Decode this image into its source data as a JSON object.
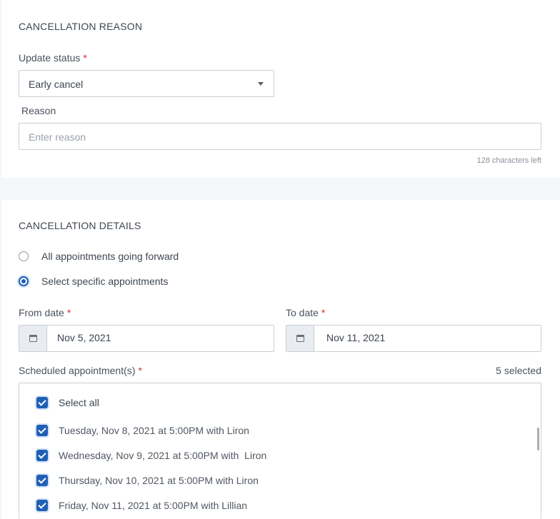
{
  "reason_section": {
    "title": "CANCELLATION REASON",
    "status_label": "Update status",
    "required_mark": "*",
    "status_value": "Early cancel",
    "reason_label": "Reason",
    "reason_placeholder": "Enter reason",
    "chars_left": "128 characters left"
  },
  "details_section": {
    "title": "CANCELLATION DETAILS",
    "options": [
      {
        "label": "All appointments going forward",
        "selected": false
      },
      {
        "label": "Select specific appointments",
        "selected": true
      }
    ],
    "from_label": "From date",
    "from_value": "Nov 5, 2021",
    "to_label": "To date",
    "to_value": "Nov 11, 2021",
    "required_mark": "*",
    "appointments_label": "Scheduled appointment(s)",
    "selected_count": "5 selected",
    "select_all_label": "Select all",
    "appointments": [
      "Tuesday, Nov 8, 2021 at 5:00PM with Liron",
      "Wednesday, Nov 9, 2021 at 5:00PM with  Liron",
      "Thursday, Nov 10, 2021 at 5:00PM with Liron",
      "Friday, Nov 11, 2021 at 5:00PM with Lillian"
    ]
  },
  "icons": {
    "status_dropdown": "chevron-down-icon",
    "date_addon": "calendar-icon",
    "checkbox": "checkmark-icon"
  },
  "colors": {
    "accent": "#1f5fb5",
    "required": "#d0312d",
    "page_background": "#f4f6f9"
  }
}
